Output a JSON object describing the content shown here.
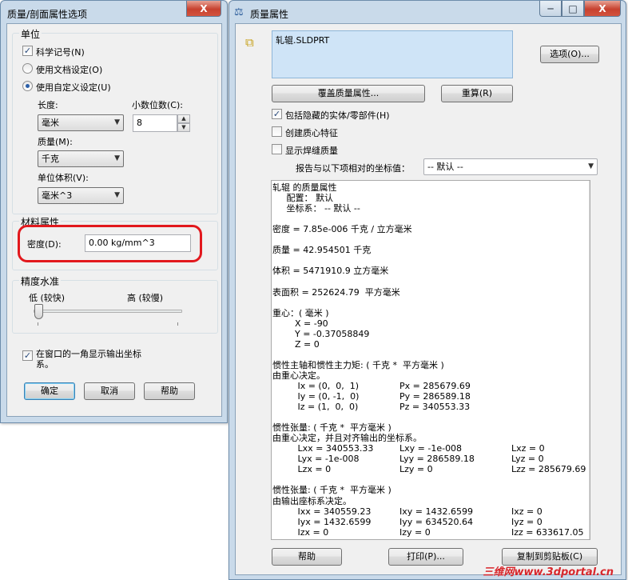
{
  "left_dialog": {
    "title": "质量/剖面属性选项",
    "close_label": "X",
    "units": {
      "group_label": "单位",
      "scientific": {
        "label": "科学记号(N)",
        "checked": true
      },
      "doc_units": {
        "label": "使用文档设定(O)"
      },
      "custom_units": {
        "label": "使用自定义设定(U)",
        "selected": true
      },
      "length_label": "长度:",
      "length_value": "毫米",
      "decimals_label": "小数位数(C):",
      "decimals_value": "8",
      "mass_label": "质量(M):",
      "mass_value": "千克",
      "volume_label": "单位体积(V):",
      "volume_value": "毫米^3"
    },
    "material": {
      "group_label": "材料属性",
      "density_label": "密度(D):",
      "density_value": "0.00 kg/mm^3"
    },
    "accuracy": {
      "group_label": "精度水准",
      "low_label": "低 (较快)",
      "high_label": "高 (较慢)",
      "level": 0.0
    },
    "show_output": {
      "label_line1": "在窗口的一角显示输出坐标",
      "label_line2": "系。",
      "checked": true
    },
    "buttons": {
      "ok": "确定",
      "cancel": "取消",
      "help": "帮助"
    }
  },
  "right_dialog": {
    "title": "质量属性",
    "caption_buttons": {
      "minimize": "─",
      "maximize": "□",
      "close": "X"
    },
    "selected_item": "轧辊.SLDPRT",
    "options_button": "选项(O)...",
    "override_button": "覆盖质量属性...",
    "recalc_button": "重算(R)",
    "include_hidden": {
      "label": "包括隐藏的实体/零部件(H)",
      "checked": true
    },
    "create_com": {
      "label": "创建质心特征",
      "checked": false
    },
    "show_weld": {
      "label": "显示焊缝质量",
      "checked": false
    },
    "report_label": "报告与以下项相对的坐标值：",
    "report_value": "-- 默认 --",
    "results": [
      "轧辊 的质量属性",
      "     配置： 默认",
      "     坐标系： -- 默认 --",
      "",
      "密度 = 7.85e-006 千克 / 立方毫米",
      "",
      "质量 = 42.954501 千克",
      "",
      "体积 = 5471910.9 立方毫米",
      "",
      "表面积 = 252624.79  平方毫米",
      "",
      "重心：( 毫米 )",
      "        X = -90",
      "        Y = -0.37058849",
      "        Z = 0",
      "",
      "惯性主轴和惯性主力矩: ( 千克 *  平方毫米 )",
      "由重心决定。",
      "         Ix = (0,  0,  1)",
      "         Iy = (0, -1,  0)",
      "         Iz = (1,  0,  0)",
      "",
      "惯性张量: ( 千克 *  平方毫米 )",
      "由重心决定，并且对齐输出的坐标系。",
      "         Lxx = 340553.33",
      "         Lyx = -1e-008",
      "         Lzx = 0",
      "",
      "惯性张量: ( 千克 *  平方毫米 )",
      "由输出座标系决定。",
      "         Ixx = 340559.23",
      "         Iyx = 1432.6599",
      "         Izx = 0"
    ],
    "results_col2": [
      {
        "row": 19,
        "text": "Px = 285679.69"
      },
      {
        "row": 20,
        "text": "Py = 286589.18"
      },
      {
        "row": 21,
        "text": "Pz = 340553.33"
      },
      {
        "row": 25,
        "text": "Lxy = -1e-008"
      },
      {
        "row": 26,
        "text": "Lyy = 286589.18"
      },
      {
        "row": 27,
        "text": "Lzy = 0"
      },
      {
        "row": 31,
        "text": "Ixy = 1432.6599"
      },
      {
        "row": 32,
        "text": "Iyy = 634520.64"
      },
      {
        "row": 33,
        "text": "Izy = 0"
      }
    ],
    "results_col3": [
      {
        "row": 25,
        "text": "Lxz = 0"
      },
      {
        "row": 26,
        "text": "Lyz = 0"
      },
      {
        "row": 27,
        "text": "Lzz = 285679.69"
      },
      {
        "row": 31,
        "text": "Ixz = 0"
      },
      {
        "row": 32,
        "text": "Iyz = 0"
      },
      {
        "row": 33,
        "text": "Izz = 633617.05"
      }
    ],
    "buttons": {
      "help": "帮助",
      "print": "打印(P)...",
      "copy": "复制到剪贴板(C)"
    }
  },
  "watermark": "三维网www.3dportal.cn",
  "colors": {
    "highlight": "#e2181d",
    "title_bar": "#c9daea",
    "selection": "#cfe4f7"
  }
}
